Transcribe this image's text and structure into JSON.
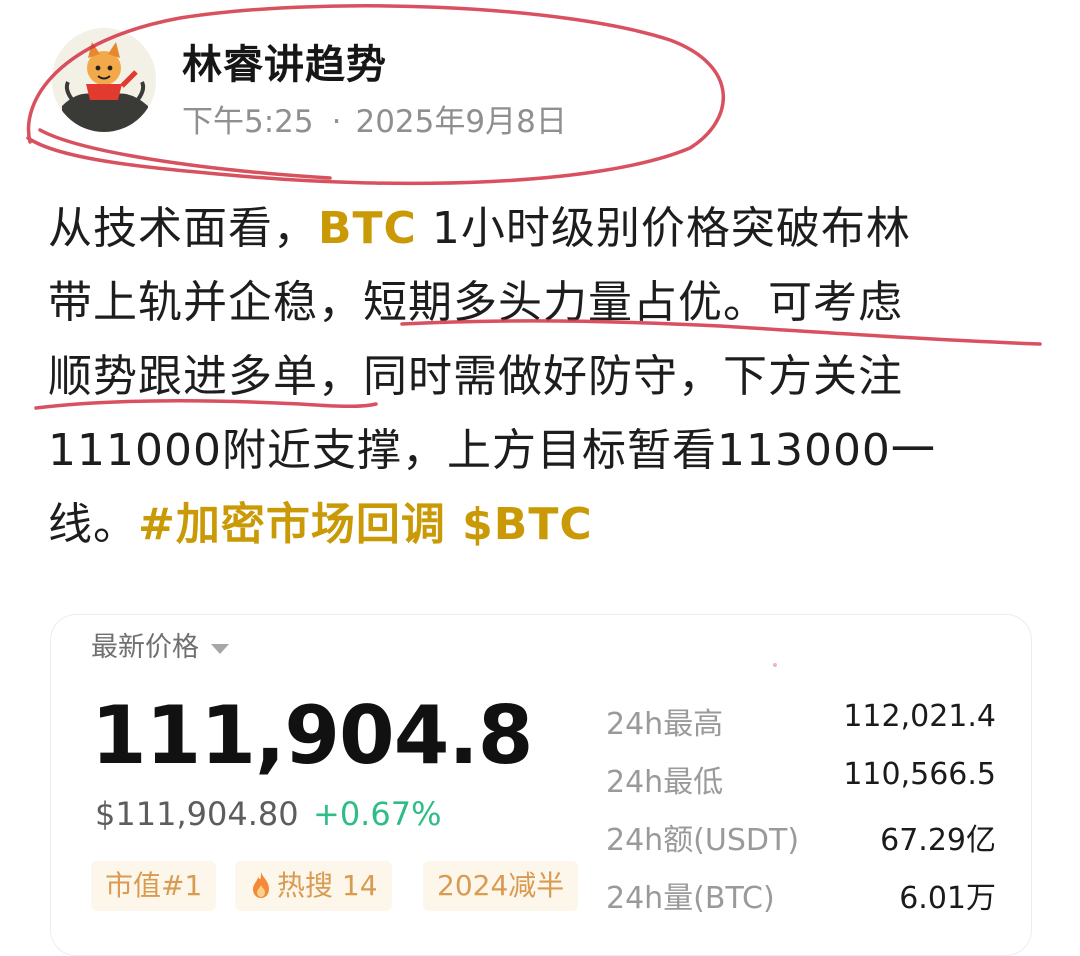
{
  "post": {
    "author": "林睿讲趋势",
    "time": "下午5:25",
    "separator": "·",
    "date": "2025年9月8日",
    "lines": [
      [
        "从技术面看，",
        "BTC",
        " 1小时级别价格突破布林"
      ],
      [
        "带上轨并企稳，短期多头力量占优。可考虑"
      ],
      [
        "顺势跟进多单，同时需做好防守，下方关注"
      ],
      [
        "111000附近支撑，上方目标暂看113000一"
      ],
      [
        "线。",
        "#加密市场回调 $BTC"
      ]
    ]
  },
  "ticker": {
    "title": "最新价格",
    "price": "111,904.8",
    "usd_price": "$111,904.80",
    "change": "+0.67%",
    "tags": [
      "市值#1",
      "热搜 14",
      "2024减半"
    ],
    "stats": [
      {
        "label": "24h最高",
        "value": "112,021.4"
      },
      {
        "label": "24h最低",
        "value": "110,566.5"
      },
      {
        "label": "24h额(USDT)",
        "value": "67.29亿"
      },
      {
        "label": "24h量(BTC)",
        "value": "6.01万"
      }
    ]
  },
  "colors": {
    "highlight": "#c99a06",
    "positive": "#2ebd85",
    "annotation": "#d23344",
    "tag_bg": "#fdf6ea",
    "tag_text": "#d99b52"
  },
  "icons": [
    "avatar-image",
    "caret-down-icon",
    "flame-icon"
  ]
}
